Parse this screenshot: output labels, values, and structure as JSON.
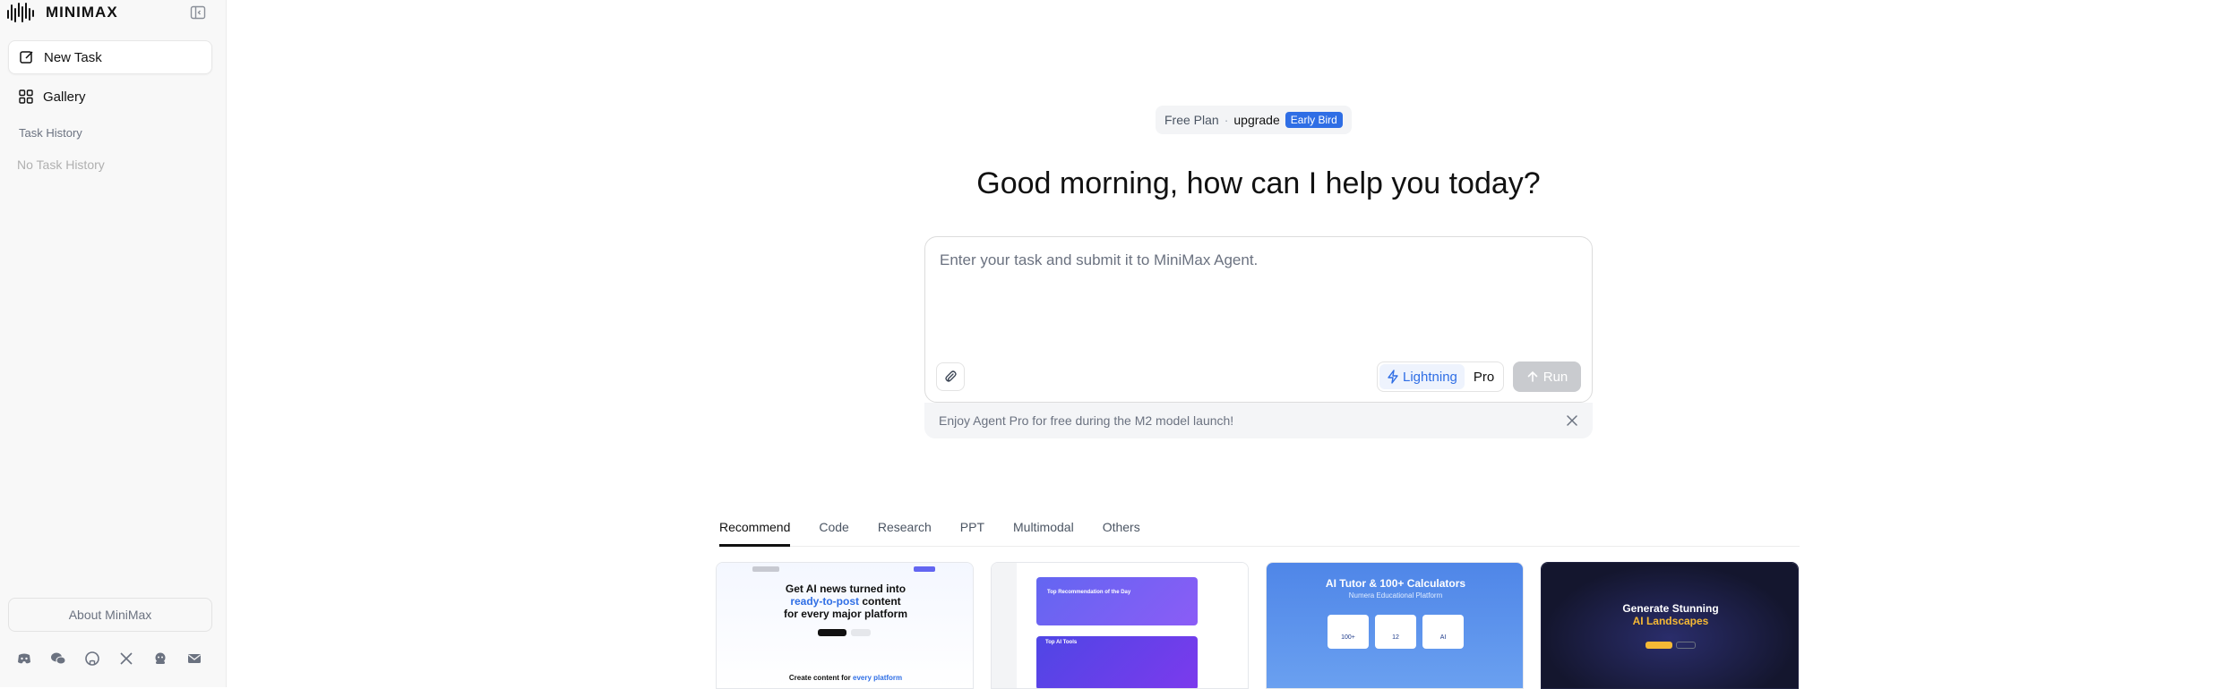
{
  "sidebar": {
    "brand_name": "MINIMAX",
    "nav": [
      {
        "label": "New Task",
        "icon": "edit-icon"
      },
      {
        "label": "Gallery",
        "icon": "grid-icon"
      }
    ],
    "history_title": "Task History",
    "history_empty": "No Task History",
    "about_label": "About MiniMax",
    "social_icons": [
      "discord-icon",
      "wechat-icon",
      "github-icon",
      "x-icon",
      "community-icon",
      "mail-icon"
    ]
  },
  "plan": {
    "name": "Free Plan",
    "separator": "·",
    "upgrade_label": "upgrade",
    "badge": "Early Bird"
  },
  "greeting": "Good morning, how can I help you today?",
  "composer": {
    "placeholder": "Enter your task and submit it to MiniMax Agent.",
    "modes": [
      {
        "label": "Lightning",
        "selected": true
      },
      {
        "label": "Pro",
        "selected": false
      }
    ],
    "run_label": "Run"
  },
  "promo": {
    "text": "Enjoy Agent Pro for free during the M2 model launch!"
  },
  "tabs": [
    "Recommend",
    "Code",
    "Research",
    "PPT",
    "Multimodal",
    "Others"
  ],
  "active_tab": "Recommend",
  "cards": [
    {
      "heading": "Get AI news turned into",
      "highlight": "ready-to-post",
      "heading_end": "content",
      "line3": "for every major platform",
      "footer": "Create content for",
      "footer_highlight": "every platform"
    },
    {
      "heading": "Top Recommendation of the Day",
      "sub": "Top AI Tools"
    },
    {
      "heading": "AI Tutor & 100+ Calculators",
      "sub": "Numera Educational Platform",
      "stats": [
        "100+",
        "12",
        "AI"
      ]
    },
    {
      "heading": "Generate Stunning",
      "highlight": "AI Landscapes"
    }
  ],
  "colors": {
    "accent": "#2f6ee5",
    "sidebar_bg": "#f8f8f8",
    "run_disabled": "#c9cbcf"
  }
}
